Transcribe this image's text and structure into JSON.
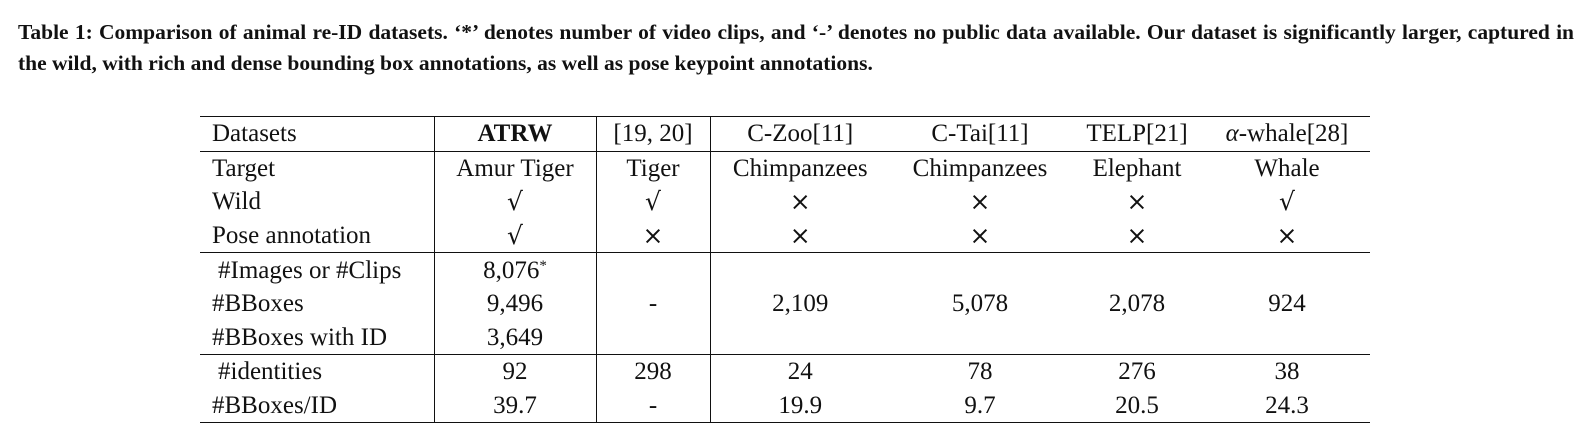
{
  "caption": {
    "label": "Table 1:",
    "text": "Comparison of animal re-ID datasets. ‘*’ denotes number of video clips, and ‘-’ denotes no public data available. Our dataset is significantly larger, captured in the wild, with rich and dense bounding box annotations, as well as pose keypoint annotations."
  },
  "table": {
    "columns": [
      "Datasets",
      "ATRW",
      "[19, 20]",
      "C-Zoo[11]",
      "C-Tai[11]",
      "TELP[21]",
      "α-whale[28]"
    ],
    "alpha_symbol": "α",
    "whale_label": "-whale[28]",
    "rows": {
      "target": {
        "label": "Target",
        "values": [
          "Amur Tiger",
          "Tiger",
          "Chimpanzees",
          "Chimpanzees",
          "Elephant",
          "Whale"
        ]
      },
      "wild": {
        "label": "Wild",
        "values": [
          "√",
          "√",
          "×",
          "×",
          "×",
          "√"
        ]
      },
      "pose": {
        "label": "Pose annotation",
        "values": [
          "√",
          "×",
          "×",
          "×",
          "×",
          "×"
        ]
      },
      "images": {
        "label": "#Images or #Clips",
        "atrw": "8,076",
        "atrw_mark": "*"
      },
      "bboxes": {
        "label": "#BBoxes",
        "atrw": "9,496",
        "others": [
          "-",
          "2,109",
          "5,078",
          "2,078",
          "924"
        ]
      },
      "bboxes_id": {
        "label": "#BBoxes with ID",
        "atrw": "3,649"
      },
      "identities": {
        "label": "#identities",
        "values": [
          "92",
          "298",
          "24",
          "78",
          "276",
          "38"
        ]
      },
      "bboxes_per_id": {
        "label": "#BBoxes/ID",
        "values": [
          "39.7",
          "-",
          "19.9",
          "9.7",
          "20.5",
          "24.3"
        ]
      }
    }
  }
}
